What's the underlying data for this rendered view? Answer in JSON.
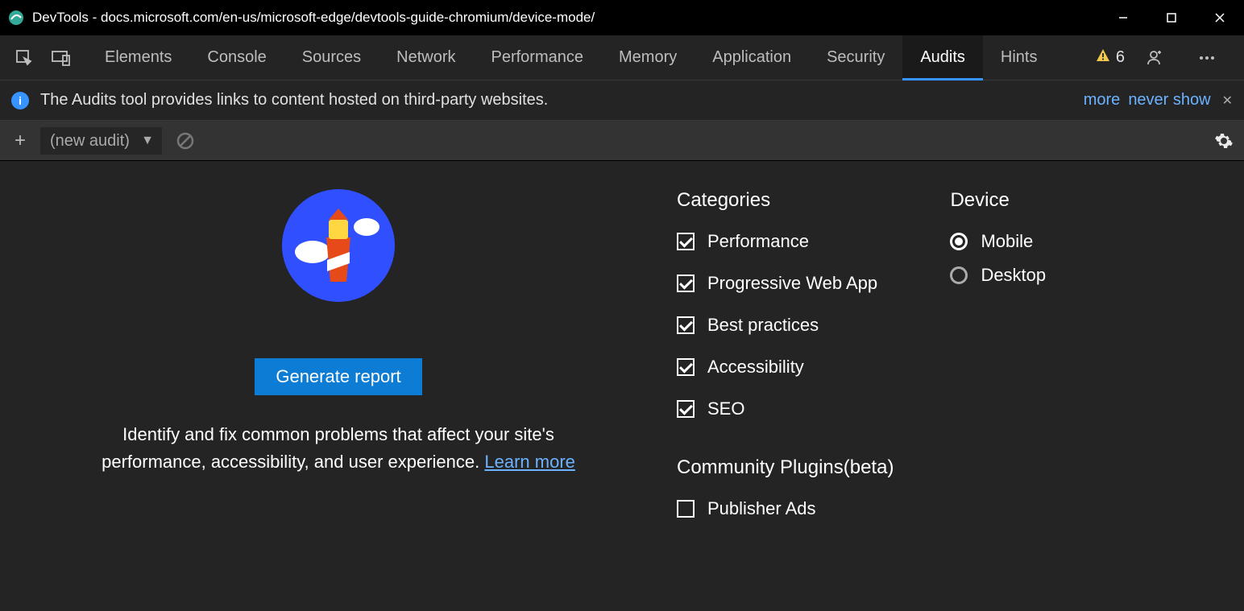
{
  "window": {
    "title": "DevTools - docs.microsoft.com/en-us/microsoft-edge/devtools-guide-chromium/device-mode/"
  },
  "toolbar": {
    "tabs": [
      "Elements",
      "Console",
      "Sources",
      "Network",
      "Performance",
      "Memory",
      "Application",
      "Security",
      "Audits",
      "Hints"
    ],
    "active_tab": "Audits",
    "warning_count": "6"
  },
  "info_bar": {
    "text": "The Audits tool provides links to content hosted on third-party websites.",
    "more": "more",
    "never_show": "never show"
  },
  "sub_toolbar": {
    "select_value": "(new audit)"
  },
  "main": {
    "generate_label": "Generate report",
    "description_prefix": "Identify and fix common problems that affect your site's performance, accessibility, and user experience. ",
    "learn_more": "Learn more",
    "categories_title": "Categories",
    "categories": [
      {
        "label": "Performance",
        "checked": true
      },
      {
        "label": "Progressive Web App",
        "checked": true
      },
      {
        "label": "Best practices",
        "checked": true
      },
      {
        "label": "Accessibility",
        "checked": true
      },
      {
        "label": "SEO",
        "checked": true
      }
    ],
    "community_title": "Community Plugins(beta)",
    "community": [
      {
        "label": "Publisher Ads",
        "checked": false
      }
    ],
    "device_title": "Device",
    "devices": [
      {
        "label": "Mobile",
        "selected": true
      },
      {
        "label": "Desktop",
        "selected": false
      }
    ]
  }
}
